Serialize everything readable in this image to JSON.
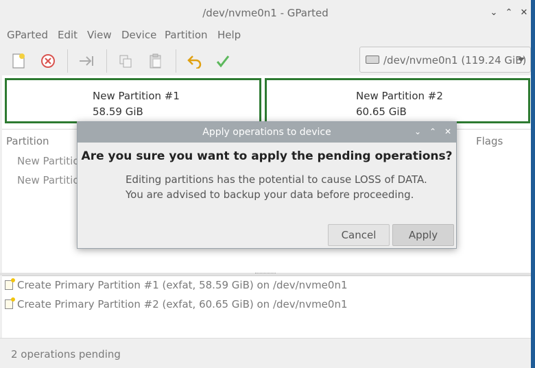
{
  "window": {
    "title": "/dev/nvme0n1 - GParted"
  },
  "menubar": {
    "items": [
      "GParted",
      "Edit",
      "View",
      "Device",
      "Partition",
      "Help"
    ]
  },
  "toolbar": {
    "buttons": [
      "new-icon",
      "delete-icon",
      "resize-move-icon",
      "copy-icon",
      "paste-icon",
      "undo-icon",
      "apply-icon"
    ]
  },
  "device_selector": {
    "value": "/dev/nvme0n1 (119.24 GiB)"
  },
  "partitions": [
    {
      "name": "New Partition #1",
      "size": "58.59 GiB"
    },
    {
      "name": "New Partition #2",
      "size": "60.65 GiB"
    }
  ],
  "table": {
    "columns": {
      "partition": "Partition",
      "flags": "Flags"
    },
    "rows": [
      "New Partitio",
      "New Partitio"
    ]
  },
  "operations": [
    "Create Primary Partition #1 (exfat, 58.59 GiB) on /dev/nvme0n1",
    "Create Primary Partition #2 (exfat, 60.65 GiB) on /dev/nvme0n1"
  ],
  "statusbar": {
    "text": "2 operations pending"
  },
  "dialog": {
    "title": "Apply operations to device",
    "question": "Are you sure you want to apply the pending operations?",
    "message_line1": "Editing partitions has the potential to cause LOSS of DATA.",
    "message_line2": "You are advised to backup your data before proceeding.",
    "cancel_label": "Cancel",
    "apply_label": "Apply"
  },
  "colors": {
    "partition_border": "#2d7a31",
    "dialog_titlebar": "#a2a9ae"
  }
}
